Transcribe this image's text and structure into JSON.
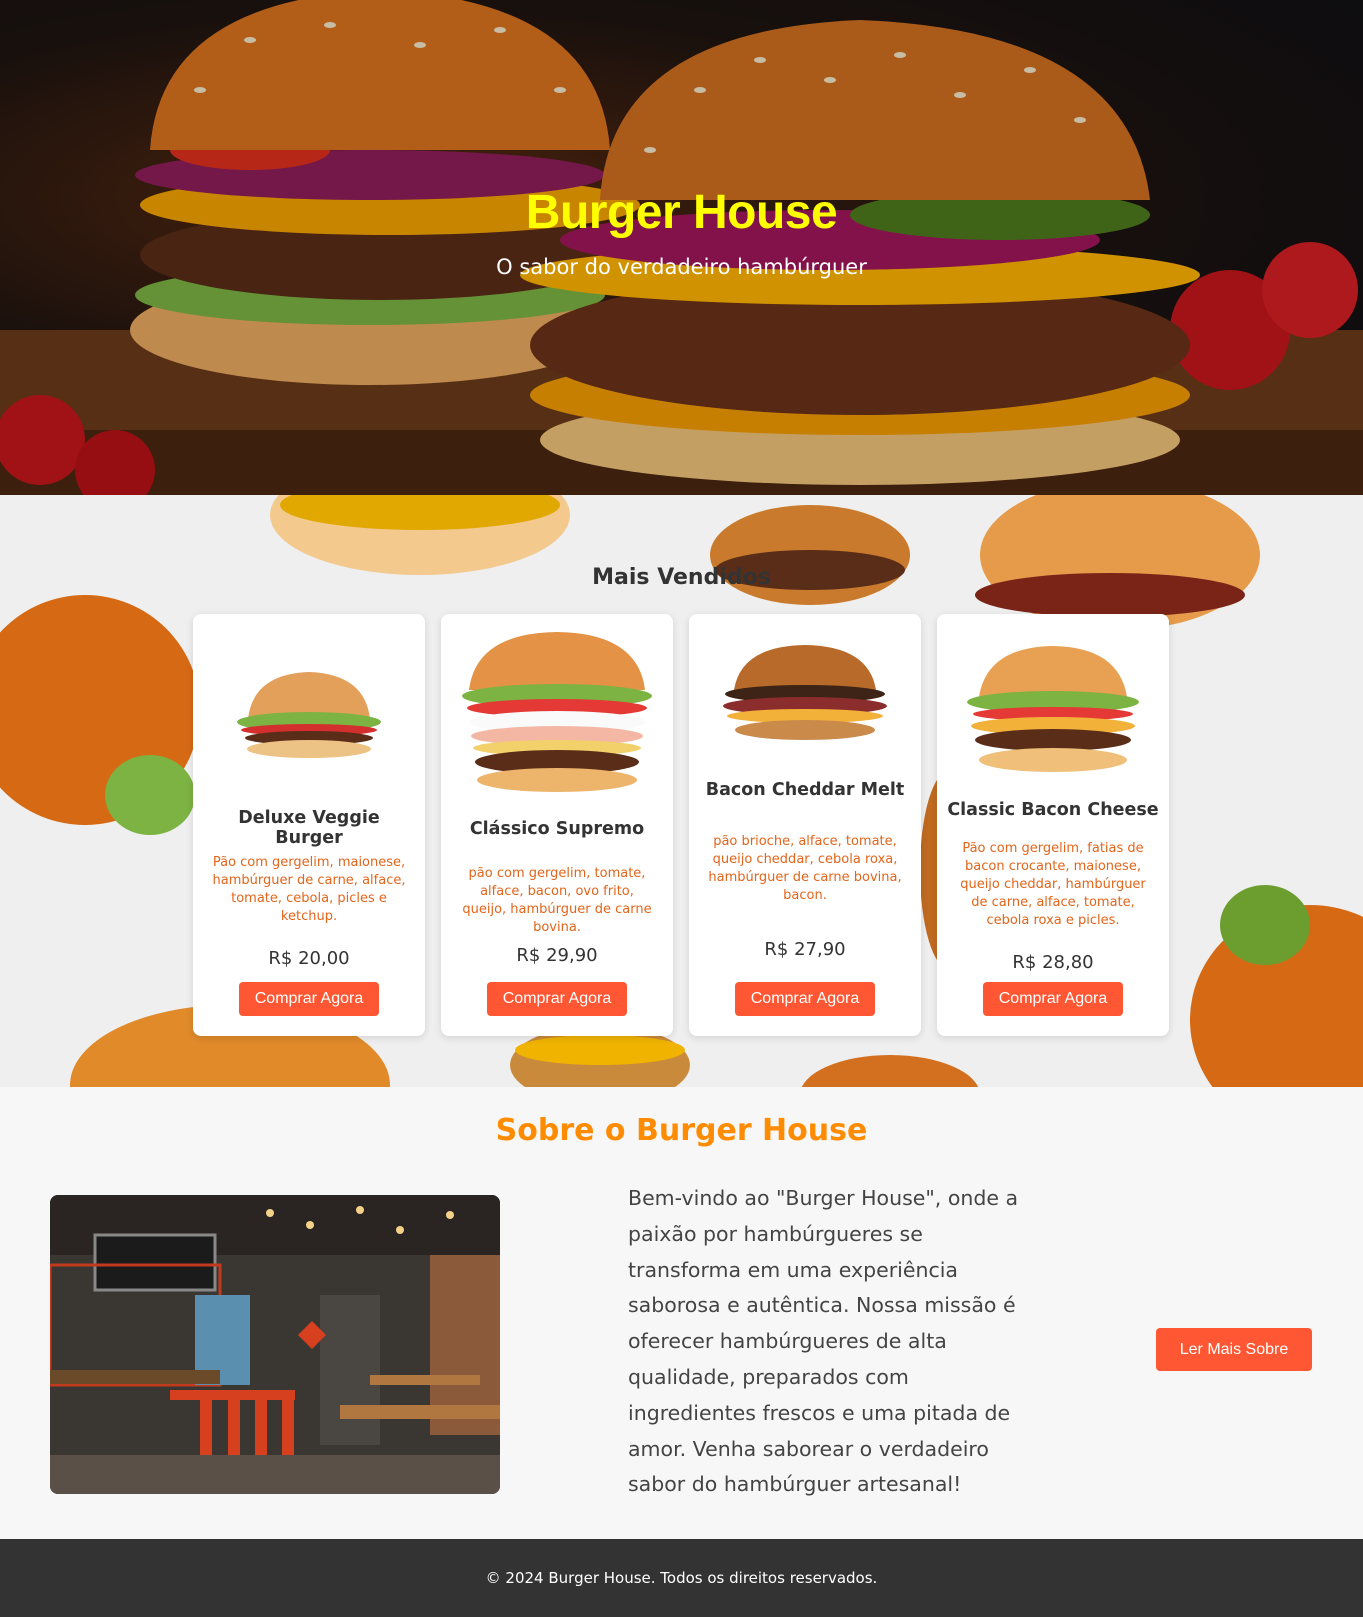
{
  "hero": {
    "title": "Burger House",
    "subtitle": "O sabor do verdadeiro hambúrguer"
  },
  "best_sellers": {
    "title": "Mais Vendidos",
    "items": [
      {
        "name": "Deluxe Veggie Burger",
        "description": "Pão com gergelim, maionese, hambúrguer de carne, alface, tomate, cebola, picles e ketchup.",
        "price": "R$ 20,00",
        "button": "Comprar Agora"
      },
      {
        "name": "Clássico Supremo",
        "description": "pão com gergelim, tomate, alface, bacon, ovo frito, queijo, hambúrguer de carne bovina.",
        "price": "R$ 29,90",
        "button": "Comprar Agora"
      },
      {
        "name": "Bacon Cheddar Melt",
        "description": "pão brioche, alface, tomate, queijo cheddar, cebola roxa, hambúrguer de carne bovina, bacon.",
        "price": "R$ 27,90",
        "button": "Comprar Agora"
      },
      {
        "name": "Classic Bacon Cheese",
        "description": "Pão com gergelim, fatias de bacon crocante, maionese, queijo cheddar, hambúrguer de carne, alface, tomate, cebola roxa e picles.",
        "price": "R$ 28,80",
        "button": "Comprar Agora"
      }
    ]
  },
  "about": {
    "title": "Sobre o Burger House",
    "text": "Bem-vindo ao \"Burger House\", onde a paixão por hambúrgueres se transforma em uma experiência saborosa e autêntica. Nossa missão é oferecer hambúrgueres de alta qualidade, preparados com ingredientes frescos e uma pitada de amor. Venha saborear o verdadeiro sabor do hambúrguer artesanal!",
    "button": "Ler Mais Sobre"
  },
  "footer": {
    "text": "© 2024 Burger House. Todos os direitos reservados."
  },
  "colors": {
    "accent": "#ff5733",
    "hero_title": "#ffff00",
    "about_title": "#ff8c00",
    "description": "#e2651b",
    "footer_bg": "#333333"
  }
}
